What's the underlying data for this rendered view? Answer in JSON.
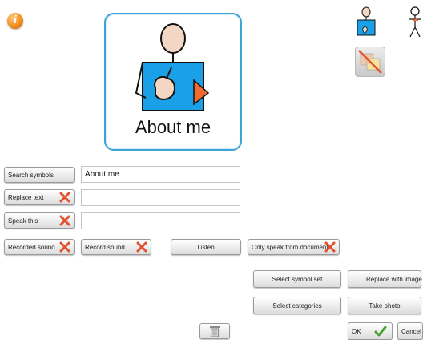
{
  "symbol": {
    "label": "About me"
  },
  "fields": {
    "search_symbols_label": "Search symbols",
    "search_value": "About me",
    "replace_text_label": "Replace text",
    "replace_value": "",
    "speak_this_label": "Speak this",
    "speak_value": ""
  },
  "sound": {
    "recorded_sound_label": "Recorded sound",
    "record_sound_label": "Record sound",
    "listen_label": "Listen",
    "only_speak_label": "Only speak from document"
  },
  "actions": {
    "select_symbol_set": "Select symbol set",
    "replace_with_image": "Replace with image",
    "select_categories": "Select categories",
    "take_photo": "Take photo",
    "ok": "OK",
    "cancel": "Cancel"
  },
  "icons": {
    "info": "info-icon",
    "remove": "red-x-icon",
    "ok": "green-check-icon",
    "delete": "trash-icon"
  },
  "colors": {
    "card_border": "#3ba3d8",
    "remove_red": "#e2502d",
    "check_green": "#46a02d",
    "shirt_blue": "#1aa0e6"
  }
}
